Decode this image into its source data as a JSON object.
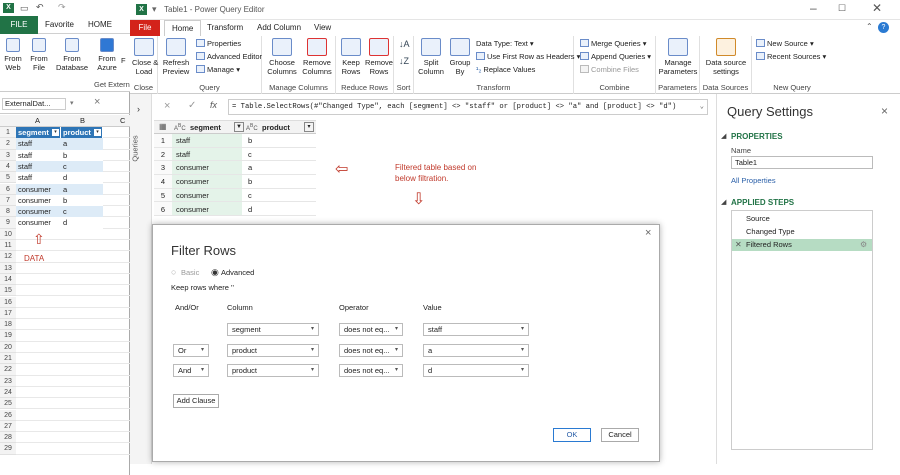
{
  "excel": {
    "tabs": [
      "FILE",
      "Favorite",
      "HOME"
    ],
    "ribbon": [
      {
        "label": "From\nWeb"
      },
      {
        "label": "From\nFile"
      },
      {
        "label": "From\nDatabase"
      },
      {
        "label": "From\nAzure"
      },
      {
        "label": "F"
      }
    ],
    "group_label": "Get Extern",
    "name_box": "ExternalDat...",
    "columns": [
      "A",
      "B",
      "C"
    ],
    "headers": [
      "segment",
      "product"
    ],
    "rows": [
      [
        "staff",
        "a"
      ],
      [
        "staff",
        "b"
      ],
      [
        "staff",
        "c"
      ],
      [
        "staff",
        "d"
      ],
      [
        "consumer",
        "a"
      ],
      [
        "consumer",
        "b"
      ],
      [
        "consumer",
        "c"
      ],
      [
        "consumer",
        "d"
      ]
    ],
    "row_numbers": [
      "1",
      "2",
      "3",
      "4",
      "5",
      "6",
      "7",
      "8",
      "9",
      "10",
      "11",
      "12",
      "13",
      "14",
      "15",
      "16",
      "17",
      "18",
      "19",
      "20",
      "21",
      "22",
      "23",
      "24",
      "25",
      "26",
      "27",
      "28",
      "29"
    ],
    "annotation": "DATA"
  },
  "pq": {
    "title": "Table1 - Power Query Editor",
    "tabs": [
      "File",
      "Home",
      "Transform",
      "Add Column",
      "View"
    ],
    "groups": {
      "close": "Close",
      "query": "Query",
      "manage_columns": "Manage Columns",
      "reduce_rows": "Reduce Rows",
      "sort": "Sort",
      "transform": "Transform",
      "combine": "Combine",
      "parameters": "Parameters",
      "data_sources": "Data Sources",
      "new_query": "New Query"
    },
    "buttons": {
      "close_load": "Close &\nLoad",
      "refresh": "Refresh\nPreview",
      "properties": "Properties",
      "advanced_editor": "Advanced Editor",
      "manage": "Manage",
      "choose_cols": "Choose\nColumns",
      "remove_cols": "Remove\nColumns",
      "keep_rows": "Keep\nRows",
      "remove_rows": "Remove\nRows",
      "split": "Split\nColumn",
      "group_by": "Group\nBy",
      "data_type": "Data Type: Text",
      "first_row": "Use First Row as Headers",
      "replace": "Replace Values",
      "merge": "Merge Queries",
      "append": "Append Queries",
      "combine_files": "Combine Files",
      "manage_params": "Manage\nParameters",
      "ds_settings": "Data source\nsettings",
      "new_source": "New Source",
      "recent_sources": "Recent Sources"
    },
    "queries_label": "Queries",
    "formula": "= Table.SelectRows(#\"Changed Type\", each [segment] <> \"staff\" or [product] <> \"a\" and [product] <> \"d\")",
    "grid_headers": [
      "segment",
      "product"
    ],
    "grid_rows": [
      [
        "1",
        "staff",
        "b"
      ],
      [
        "2",
        "staff",
        "c"
      ],
      [
        "3",
        "consumer",
        "a"
      ],
      [
        "4",
        "consumer",
        "b"
      ],
      [
        "5",
        "consumer",
        "c"
      ],
      [
        "6",
        "consumer",
        "d"
      ]
    ],
    "annotation": "Filtered table based on\nbelow filtration."
  },
  "settings": {
    "title": "Query Settings",
    "properties": "PROPERTIES",
    "name_label": "Name",
    "name_value": "Table1",
    "all_properties": "All Properties",
    "applied_steps": "APPLIED STEPS",
    "steps": [
      "Source",
      "Changed Type",
      "Filtered Rows"
    ]
  },
  "dialog": {
    "title": "Filter Rows",
    "basic": "Basic",
    "advanced": "Advanced",
    "keep": "Keep rows where ''",
    "headers": [
      "And/Or",
      "Column",
      "Operator",
      "Value"
    ],
    "rows": [
      {
        "andor": "",
        "column": "segment",
        "op": "does not eq...",
        "value": "staff"
      },
      {
        "andor": "Or",
        "column": "product",
        "op": "does not eq...",
        "value": "a"
      },
      {
        "andor": "And",
        "column": "product",
        "op": "does not eq...",
        "value": "d"
      }
    ],
    "add_clause": "Add Clause",
    "ok": "OK",
    "cancel": "Cancel"
  }
}
